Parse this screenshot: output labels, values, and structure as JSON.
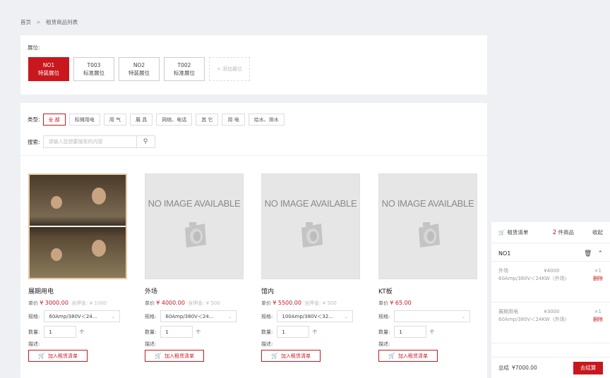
{
  "breadcrumb": {
    "home": "首页",
    "separator": ">",
    "current": "租赁商品列表"
  },
  "booth": {
    "label": "展位:",
    "cards": [
      {
        "code": "NO1",
        "type": "特装展位",
        "active": true
      },
      {
        "code": "T003",
        "type": "标准展位",
        "active": false
      },
      {
        "code": "NO2",
        "type": "特装展位",
        "active": false
      },
      {
        "code": "T002",
        "type": "标准展位",
        "active": false
      }
    ],
    "add_label": "+ 添加展位"
  },
  "filter": {
    "type_label": "类型:",
    "types": [
      "全 部",
      "标摊用电",
      "用 气",
      "展 具",
      "网络、电话",
      "其 它",
      "用 电",
      "给水、排水"
    ],
    "search_label": "搜索:",
    "search_placeholder": "请输入您想要搜索的内容",
    "search_icon": "search-icon"
  },
  "products": [
    {
      "name": "展期用电",
      "price_label": "单价",
      "price": "¥ 3000.00",
      "deposit": "含押金: ¥ 1000",
      "spec_label": "规格:",
      "spec": "60Amp/380V＜24...",
      "qty_label": "数量:",
      "qty": "1",
      "unit": "个",
      "desc_label": "描述:",
      "add_label": "加入租赁清单",
      "image": "photo"
    },
    {
      "name": "外场",
      "price_label": "单价",
      "price": "¥ 4000.00",
      "deposit": "含押金: ¥ 500",
      "spec_label": "规格:",
      "spec": "60Amp/380V＜24...",
      "qty_label": "数量:",
      "qty": "1",
      "unit": "个",
      "desc_label": "描述:",
      "add_label": "加入租赁清单",
      "image": "none"
    },
    {
      "name": "馆内",
      "price_label": "单价",
      "price": "¥ 5500.00",
      "deposit": "含押金: ¥ 500",
      "spec_label": "规格:",
      "spec": "100Amp/380V＜32...",
      "qty_label": "数量:",
      "qty": "1",
      "unit": "个",
      "desc_label": "描述:",
      "add_label": "加入租赁清单",
      "image": "none"
    },
    {
      "name": "KT板",
      "price_label": "单价",
      "price": "¥ 65.00",
      "deposit": "",
      "spec_label": "规格:",
      "spec": "",
      "qty_label": "数量:",
      "qty": "1",
      "unit": "个",
      "desc_label": "描述:",
      "add_label": "加入租赁清单",
      "image": "none"
    }
  ],
  "no_image_text": "NO IMAGE AVAILABLE",
  "cart": {
    "title": "租赁清单",
    "count": "2",
    "count_suffix": "件商品",
    "collapse_label": "收起",
    "group": "NO1",
    "items": [
      {
        "name": "外场",
        "price": "¥4000",
        "qty": "×1",
        "spec": "60Amp/380V＜24KW（外场）",
        "delete_label": "删除"
      },
      {
        "name": "展期用电",
        "price": "¥3000",
        "qty": "×1",
        "spec": "60Amp/380V＜24KW（外场）",
        "delete_label": "删除"
      }
    ],
    "total_label": "总结",
    "total": "¥7000.00",
    "checkout_label": "去结算"
  },
  "colors": {
    "accent": "#c9171e",
    "page_bg": "#eef0f4"
  }
}
